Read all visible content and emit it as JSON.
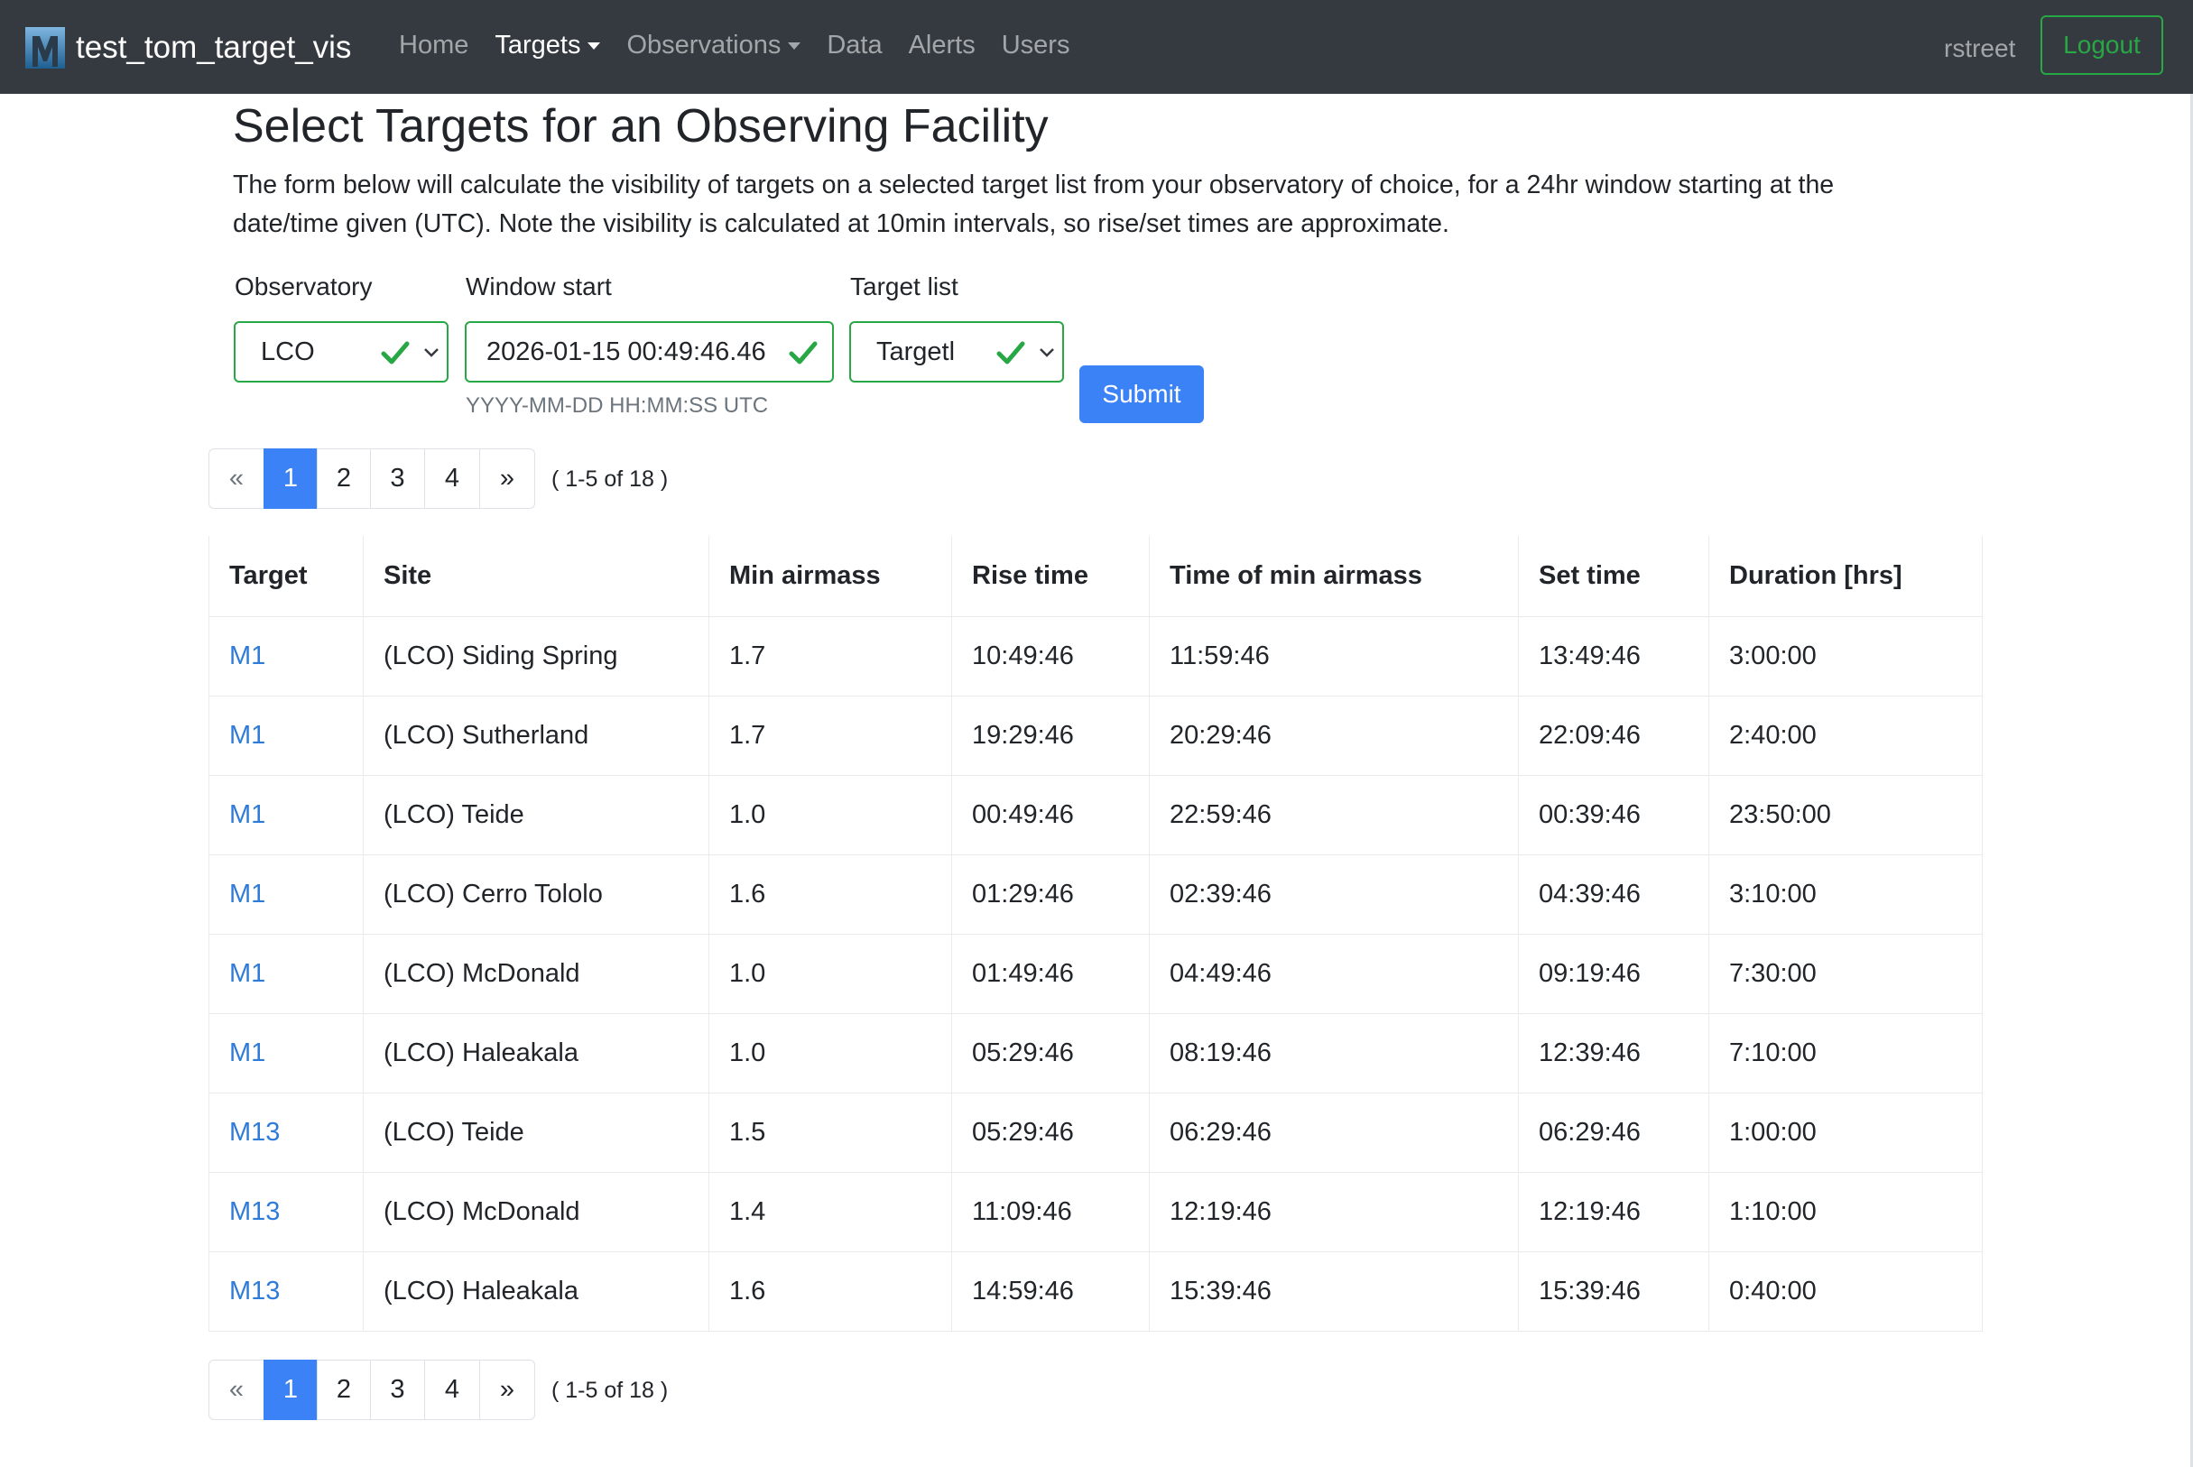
{
  "navbar": {
    "brand": "test_tom_target_vis",
    "links": [
      "Home",
      "Targets",
      "Observations",
      "Data",
      "Alerts",
      "Users"
    ],
    "user": "rstreet",
    "logout": "Logout"
  },
  "page": {
    "title": "Select Targets for an Observing Facility",
    "description_line1": "The form below will calculate the visibility of targets on a selected target list from your observatory of choice, for a 24hr window starting at the",
    "description_line2": "date/time given (UTC). Note the visibility is calculated at 10min intervals, so rise/set times are approximate."
  },
  "form": {
    "observatory_label": "Observatory",
    "observatory_value": "LCO",
    "window_label": "Window start",
    "window_value": "2026-01-15 00:49:46.46",
    "window_help": "YYYY-MM-DD HH:MM:SS UTC",
    "targetlist_label": "Target list",
    "targetlist_value": "Targetl",
    "submit": "Submit"
  },
  "pagination": {
    "prev": "«",
    "pages": [
      "1",
      "2",
      "3",
      "4"
    ],
    "next": "»",
    "active_page": "1",
    "info": "( 1-5 of 18 )"
  },
  "table": {
    "headers": [
      "Target",
      "Site",
      "Min airmass",
      "Rise time",
      "Time of min airmass",
      "Set time",
      "Duration [hrs]"
    ],
    "rows": [
      [
        "M1",
        "(LCO) Siding Spring",
        "1.7",
        "10:49:46",
        "11:59:46",
        "13:49:46",
        "3:00:00"
      ],
      [
        "M1",
        "(LCO) Sutherland",
        "1.7",
        "19:29:46",
        "20:29:46",
        "22:09:46",
        "2:40:00"
      ],
      [
        "M1",
        "(LCO) Teide",
        "1.0",
        "00:49:46",
        "22:59:46",
        "00:39:46",
        "23:50:00"
      ],
      [
        "M1",
        "(LCO) Cerro Tololo",
        "1.6",
        "01:29:46",
        "02:39:46",
        "04:39:46",
        "3:10:00"
      ],
      [
        "M1",
        "(LCO) McDonald",
        "1.0",
        "01:49:46",
        "04:49:46",
        "09:19:46",
        "7:30:00"
      ],
      [
        "M1",
        "(LCO) Haleakala",
        "1.0",
        "05:29:46",
        "08:19:46",
        "12:39:46",
        "7:10:00"
      ],
      [
        "M13",
        "(LCO) Teide",
        "1.5",
        "05:29:46",
        "06:29:46",
        "06:29:46",
        "1:00:00"
      ],
      [
        "M13",
        "(LCO) McDonald",
        "1.4",
        "11:09:46",
        "12:19:46",
        "12:19:46",
        "1:10:00"
      ],
      [
        "M13",
        "(LCO) Haleakala",
        "1.6",
        "14:59:46",
        "15:39:46",
        "15:39:46",
        "0:40:00"
      ]
    ]
  },
  "colors": {
    "navbar_bg": "#343a40",
    "primary": "#3b82f6",
    "success": "#28a745",
    "link": "#2f7bd8"
  },
  "icons": {
    "brand_logo": "brand-logo-icon",
    "valid": "check-icon",
    "select": "chevron-down-icon"
  }
}
